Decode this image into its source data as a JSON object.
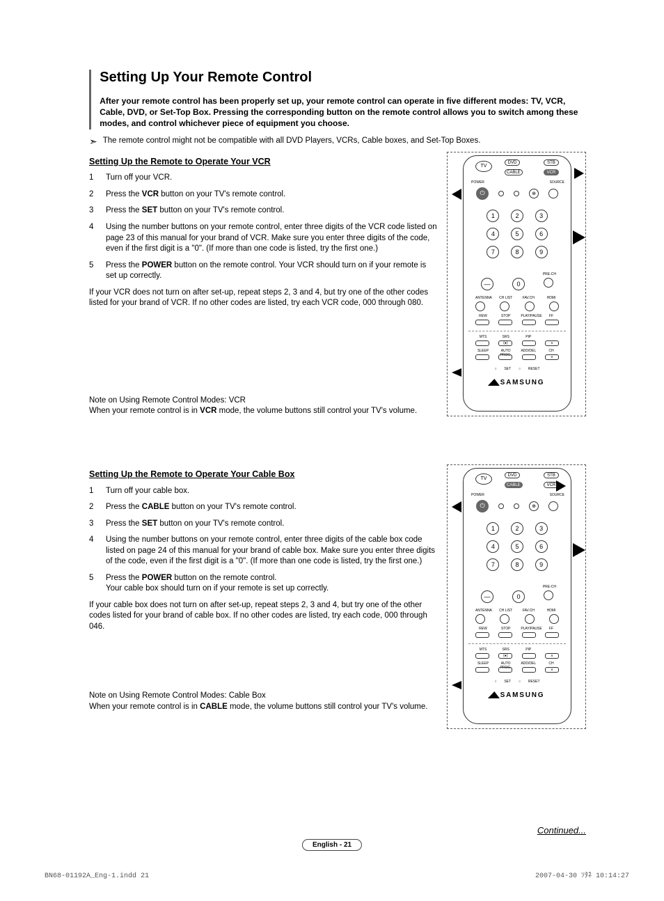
{
  "title": "Setting Up Your Remote Control",
  "intro": "After your remote control has been properly set up, your remote control can operate in five different modes: TV, VCR, Cable, DVD, or Set-Top Box. Pressing the corresponding button on the remote control allows you to switch among these modes, and control whichever piece of equipment you choose.",
  "compat_note": "The remote control might not be compatible with all DVD Players, VCRs, Cable boxes, and Set-Top Boxes.",
  "section1": {
    "title": "Setting Up the Remote to Operate Your VCR",
    "steps": [
      "Turn off your VCR.",
      "Press the <b>VCR</b> button on your TV's remote control.",
      "Press the <b>SET</b> button on your TV's remote control.",
      "Using the number buttons on your remote control, enter three digits of the VCR code listed on page 23 of this manual for your brand of VCR. Make sure you enter three digits of the code, even if the first digit is a \"0\". (If more than one code is listed, try the first one.)",
      "Press the <b>POWER</b> button on the remote control. Your VCR should turn on if your remote is set up correctly."
    ],
    "fallback": "If your VCR does not turn on after set-up, repeat steps 2, 3 and 4, but try one of the other codes listed for your brand of VCR. If no other codes are listed, try each VCR code, 000 through 080.",
    "note_title": "Note on Using Remote Control Modes: VCR",
    "note_body": "When your remote control is in <b>VCR</b> mode, the volume buttons still control your TV's volume."
  },
  "section2": {
    "title": "Setting Up the Remote to Operate Your Cable Box",
    "steps": [
      "Turn off your cable box.",
      "Press the <b>CABLE</b> button on your TV's remote control.",
      "Press the <b>SET</b> button on your TV's remote control.",
      "Using the number buttons on your remote control, enter three digits of the cable box code listed on page 24 of this manual for your brand of cable box. Make sure you enter three digits of the code, even if the first digit is a \"0\". (If more than one code is listed, try the first one.)",
      "Press the <b>POWER</b> button on the remote control.<br>Your cable box should turn on if your remote is set up correctly."
    ],
    "fallback": "If your cable box does not turn on after set-up, repeat steps 2, 3 and 4, but try one of the other codes listed for your brand of cable box. If no other codes are listed, try each code, 000 through 046.",
    "note_title": "Note on Using Remote Control Modes: Cable Box",
    "note_body": "When your remote control is in <b>CABLE</b> mode, the volume buttons still control your TV's volume."
  },
  "continued": "Continued...",
  "pagenum": "English - 21",
  "imprint_left": "BN68-01192A_Eng-1.indd   21",
  "imprint_right": "2007-04-30   ｿﾀﾈ 10:14:27",
  "remote": {
    "mode_buttons": [
      "TV",
      "DVD",
      "STB",
      "CABLE",
      "VCR"
    ],
    "row2_labels": [
      "POWER",
      "",
      "",
      "SOURCE"
    ],
    "numpad": [
      "1",
      "2",
      "3",
      "4",
      "5",
      "6",
      "7",
      "8",
      "9",
      "—",
      "0",
      ""
    ],
    "pre_ch": "PRE-CH",
    "row_b_labels": [
      "ANTENNA",
      "CH LIST",
      "FAV.CH",
      "HDMI"
    ],
    "row_c_labels": [
      "REW",
      "STOP",
      "PLAY/PAUSE",
      "FF"
    ],
    "row_d_labels": [
      "MTS",
      "SRS",
      "PIP",
      ""
    ],
    "row_e_labels": [
      "SLEEP",
      "AUTO PROG.",
      "ADD/DEL",
      "CH"
    ],
    "set_reset": [
      "SET",
      "RESET"
    ],
    "brand": "SAMSUNG"
  }
}
